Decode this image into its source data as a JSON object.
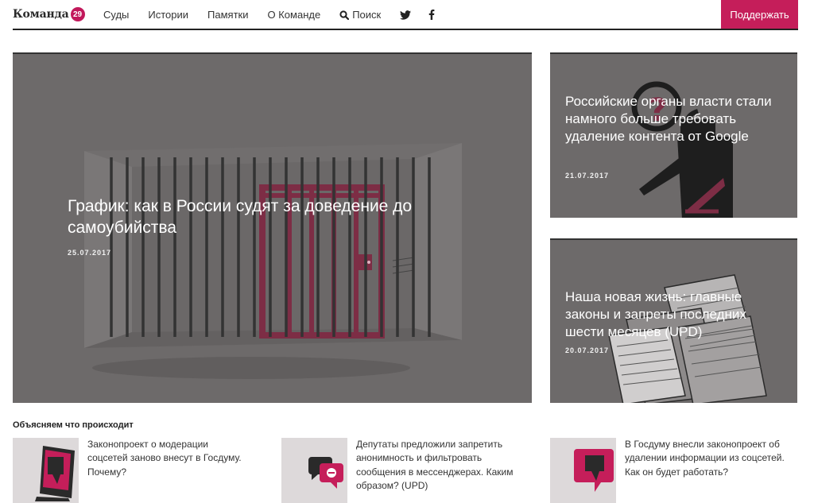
{
  "header": {
    "logo_text": "Команда",
    "logo_badge": "29",
    "nav": [
      {
        "label": "Суды"
      },
      {
        "label": "Истории"
      },
      {
        "label": "Памятки"
      },
      {
        "label": "О Команде"
      }
    ],
    "search_label": "Поиск",
    "social": [
      "twitter-icon",
      "facebook-icon"
    ],
    "support_label": "Поддержать",
    "accent_color": "#c51e5a"
  },
  "main_card": {
    "title": "График: как в России судят за доведение до самоубийства",
    "date": "25.07.2017"
  },
  "side_cards": [
    {
      "title": "Российские органы власти стали намного больше требовать удаление контента от Google",
      "date": "21.07.2017"
    },
    {
      "title": "Наша новая жизнь: главные законы и запреты последних шести месяцев (UPD)",
      "date": "20.07.2017"
    }
  ],
  "explainers": {
    "section_title": "Объясняем что происходит",
    "items": [
      {
        "text": "Законопроект о модерации соцсетей заново внесут в Госдуму. Почему?",
        "icon": "thumbs-down-monitor-icon"
      },
      {
        "text": "Депутаты предложили запретить анонимность и фильтровать сообщения в мессенджерах. Каким образом? (UPD)",
        "icon": "speech-bubbles-icon"
      },
      {
        "text": "В Госдуму внесли законопроект об удалении информации из соцсетей. Как он будет работать?",
        "icon": "thumbs-down-bubble-icon"
      }
    ]
  }
}
